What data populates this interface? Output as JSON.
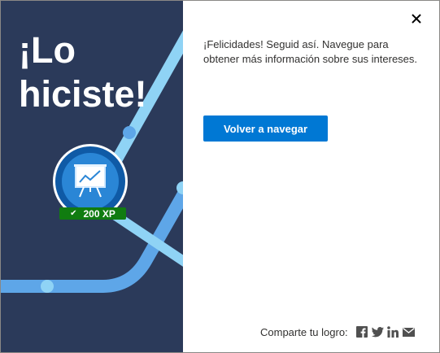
{
  "hero": {
    "line1": "¡Lo",
    "line2": "hiciste!"
  },
  "badge": {
    "icon": "presentation-board-icon",
    "xp": "200 XP"
  },
  "dialog": {
    "message": "¡Felicidades! Seguid así. Navegue para obtener más información sobre sus intereses.",
    "primary_button": "Volver a navegar",
    "close_icon": "close-icon"
  },
  "share": {
    "label": "Comparte tu logro:",
    "icons": [
      "facebook-icon",
      "twitter-icon",
      "linkedin-icon",
      "email-icon"
    ]
  },
  "colors": {
    "left_background": "#2b3a5a",
    "track_light": "#8fd3f5",
    "track_mid": "#5ea6e8",
    "primary": "#0078d4",
    "xp_ribbon": "#107c10"
  }
}
